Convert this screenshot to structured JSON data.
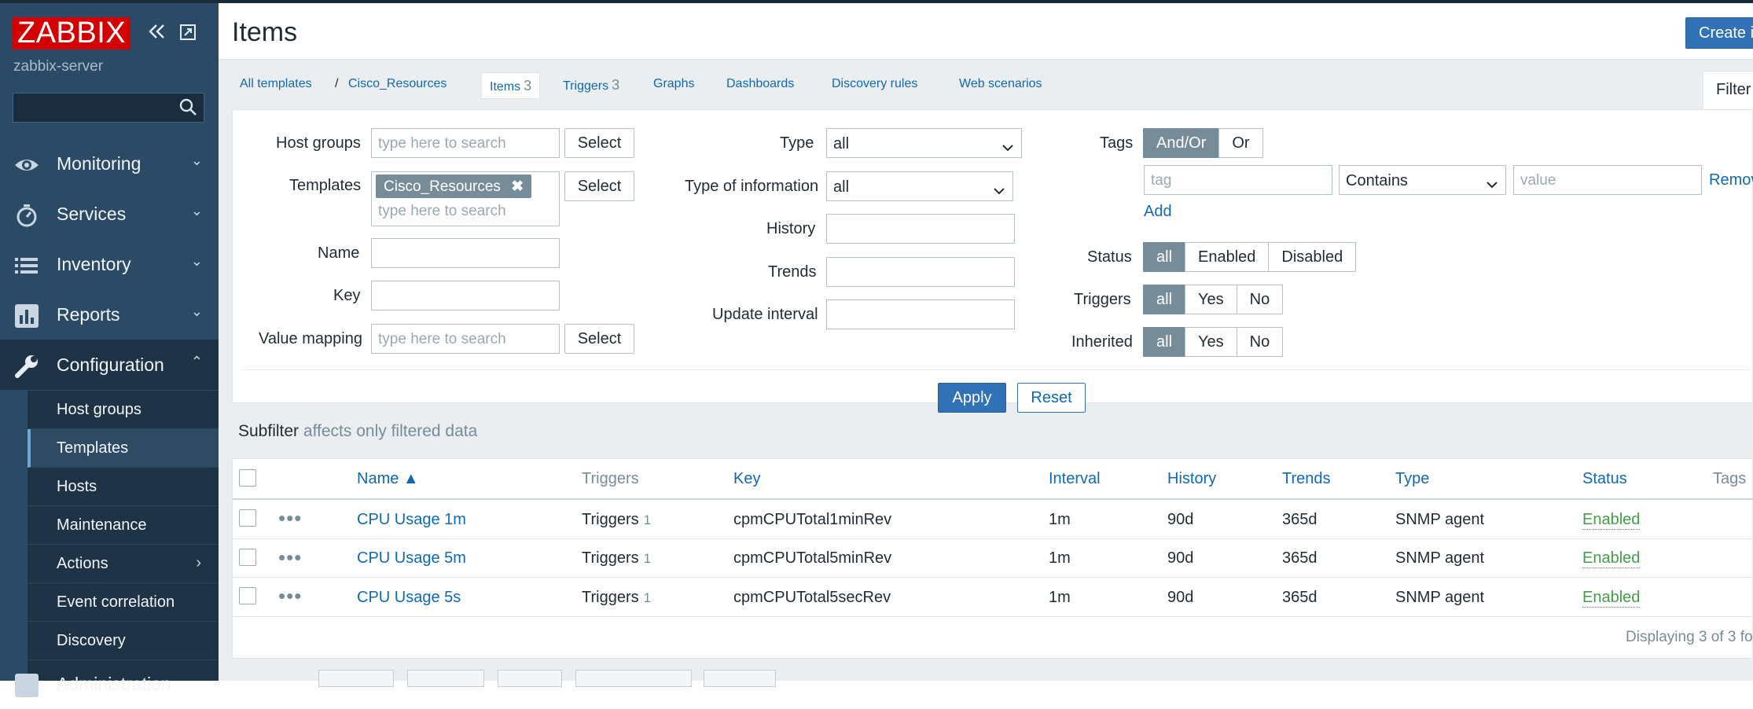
{
  "sidebar": {
    "logo": "ZABBIX",
    "collapse_icon": "double-chevron-left",
    "kiosk_icon": "fullscreen",
    "server_name": "zabbix-server",
    "search_placeholder": "",
    "menu": [
      {
        "label": "Monitoring",
        "icon": "eye"
      },
      {
        "label": "Services",
        "icon": "stopwatch"
      },
      {
        "label": "Inventory",
        "icon": "list"
      },
      {
        "label": "Reports",
        "icon": "bar-chart"
      },
      {
        "label": "Configuration",
        "icon": "wrench"
      },
      {
        "label": "Administration",
        "icon": "gear"
      }
    ],
    "submenu": [
      "Host groups",
      "Templates",
      "Hosts",
      "Maintenance",
      "Actions",
      "Event correlation",
      "Discovery"
    ]
  },
  "header": {
    "title": "Items",
    "create_label": "Create i"
  },
  "breadcrumbs": {
    "all_templates": "All templates",
    "sep": "/",
    "template": "Cisco_Resources",
    "items": "Items",
    "items_count": "3",
    "triggers": "Triggers",
    "triggers_count": "3",
    "graphs": "Graphs",
    "dashboards": "Dashboards",
    "discovery": "Discovery rules",
    "web": "Web scenarios",
    "filter_tab": "Filter"
  },
  "filter": {
    "host_groups_label": "Host groups",
    "templates_label": "Templates",
    "name_label": "Name",
    "key_label": "Key",
    "value_mapping_label": "Value mapping",
    "search_placeholder": "type here to search",
    "select_label": "Select",
    "template_chip": "Cisco_Resources",
    "type_label": "Type",
    "type_value": "all",
    "type_info_label": "Type of information",
    "type_info_value": "all",
    "history_label": "History",
    "trends_label": "Trends",
    "update_label": "Update interval",
    "tags_label": "Tags",
    "andor": "And/Or",
    "or": "Or",
    "tag_placeholder": "tag",
    "contains": "Contains",
    "value_placeholder": "value",
    "remove": "Remov",
    "add": "Add",
    "status_label": "Status",
    "triggers_label": "Triggers",
    "inherited_label": "Inherited",
    "all": "all",
    "enabled": "Enabled",
    "disabled": "Disabled",
    "yes": "Yes",
    "no": "No",
    "apply": "Apply",
    "reset": "Reset"
  },
  "subfilter": {
    "title": "Subfilter",
    "note": "affects only filtered data"
  },
  "table": {
    "columns": [
      "Name ▲",
      "Triggers",
      "Key",
      "Interval",
      "History",
      "Trends",
      "Type",
      "Status",
      "Tags"
    ],
    "rows": [
      {
        "name": "CPU Usage 1m",
        "triggers": "Triggers",
        "triggers_count": "1",
        "key": "cpmCPUTotal1minRev",
        "interval": "1m",
        "history": "90d",
        "trends": "365d",
        "type": "SNMP agent",
        "status": "Enabled"
      },
      {
        "name": "CPU Usage 5m",
        "triggers": "Triggers",
        "triggers_count": "1",
        "key": "cpmCPUTotal5minRev",
        "interval": "1m",
        "history": "90d",
        "trends": "365d",
        "type": "SNMP agent",
        "status": "Enabled"
      },
      {
        "name": "CPU Usage 5s",
        "triggers": "Triggers",
        "triggers_count": "1",
        "key": "cpmCPUTotal5secRev",
        "interval": "1m",
        "history": "90d",
        "trends": "365d",
        "type": "SNMP agent",
        "status": "Enabled"
      }
    ],
    "footer": "Displaying 3 of 3 fo"
  },
  "colors": {
    "sidebar": "#2b4a66",
    "accent": "#3171b5",
    "link": "#0f69b4",
    "enabled": "#429e47",
    "logo": "#d40000"
  }
}
